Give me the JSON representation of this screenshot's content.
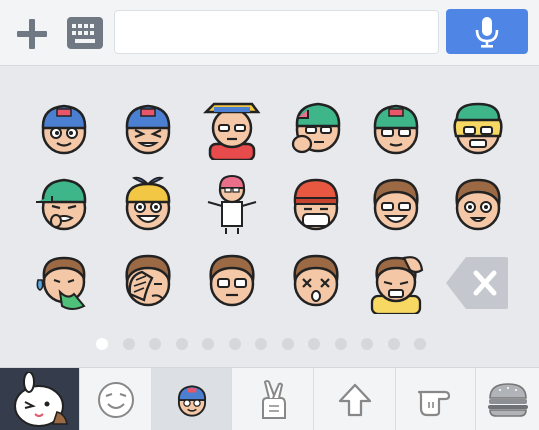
{
  "input_bar": {
    "plus_icon": "plus-icon",
    "keyboard_icon": "keyboard-icon",
    "message_value": "",
    "message_placeholder": "",
    "mic_icon": "microphone-icon",
    "accent_color": "#4f86e6"
  },
  "sticker_panel": {
    "rows": [
      [
        "cap-boy-smiling",
        "cap-boy-squinting",
        "cap-boy-glasses-red-shirt",
        "cap-boy-hand-on-chin",
        "cap-boy-glasses",
        "cap-boy-blond-glasses"
      ],
      [
        "cap-boy-crying",
        "propeller-cap-boy-laughing",
        "cap-boy-shrugging",
        "beanie-boy-masked",
        "brown-hair-boy-grinning",
        "brown-hair-boy-smiling"
      ],
      [
        "boy-vomiting",
        "boy-facepalm",
        "boy-glasses-neutral",
        "boy-dizzy",
        "boy-hands-on-head"
      ]
    ],
    "delete_icon": "backspace-icon",
    "page_count": 13,
    "active_page": 1
  },
  "tabs": {
    "items": [
      {
        "icon": "cony-brown-character-icon",
        "selected": false
      },
      {
        "icon": "emoji-face-icon",
        "selected": false
      },
      {
        "icon": "cap-boy-sticker-icon",
        "selected": true
      },
      {
        "icon": "crossed-fingers-icon",
        "selected": false
      },
      {
        "icon": "up-arrow-icon",
        "selected": false
      },
      {
        "icon": "pointing-hand-icon",
        "selected": false
      },
      {
        "icon": "burger-icon",
        "selected": false
      }
    ]
  }
}
